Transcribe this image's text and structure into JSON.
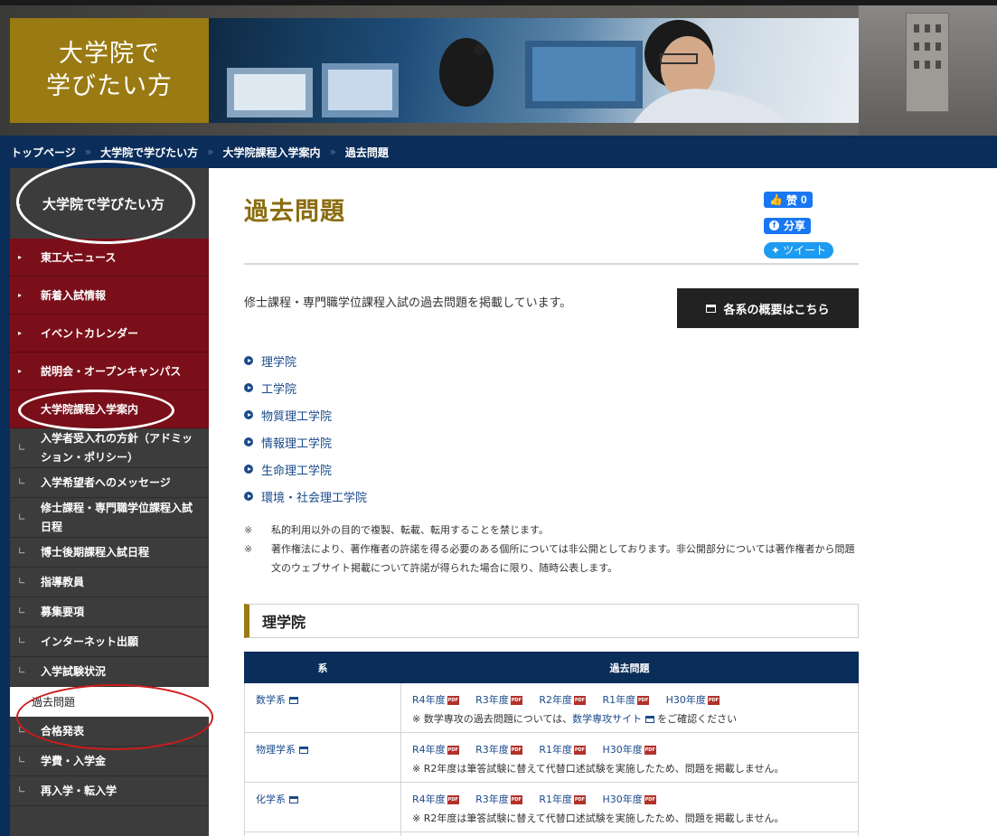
{
  "hero": {
    "title_line1": "大学院で",
    "title_line2": "学びたい方"
  },
  "breadcrumb": [
    "トップページ",
    "大学院で学びたい方",
    "大学院課程入学案内",
    "過去問題"
  ],
  "sidebar": {
    "heading": "大学院で学びたい方",
    "red_items": [
      "東工大ニュース",
      "新着入試情報",
      "イベントカレンダー",
      "説明会・オープンキャンパス",
      "大学院課程入学案内"
    ],
    "sub_items": [
      "入学者受入れの方針（アドミッション・ポリシー）",
      "入学希望者へのメッセージ",
      "修士課程・専門職学位課程入試日程",
      "博士後期課程入試日程",
      "指導教員",
      "募集要項",
      "インターネット出願",
      "入学試験状況",
      "過去問題",
      "合格発表",
      "学費・入学金",
      "再入学・転入学"
    ],
    "active_item": "過去問題"
  },
  "main": {
    "title": "過去問題",
    "social": {
      "like_label": "赞",
      "like_count": "0",
      "share_label": "分享",
      "tweet_label": "ツイート"
    },
    "intro": "修士課程・専門職学位課程入試の過去問題を掲載しています。",
    "overview_button": "各系の概要はこちら",
    "school_links": [
      "理学院",
      "工学院",
      "物質理工学院",
      "情報理工学院",
      "生命理工学院",
      "環境・社会理工学院"
    ],
    "notes": [
      {
        "mark": "※",
        "text": "私的利用以外の目的で複製、転載、転用することを禁じます。"
      },
      {
        "mark": "※",
        "text": "著作権法により、著作権者の許諾を得る必要のある個所については非公開としております。非公開部分については著作権者から問題文のウェブサイト掲載について許諾が得られた場合に限り、随時公表します。"
      }
    ],
    "section_title": "理学院",
    "table": {
      "col_dept": "系",
      "col_past": "過去問題",
      "pdf_label": "PDF",
      "rows": [
        {
          "dept": "数学系",
          "years": [
            "R4年度",
            "R3年度",
            "R2年度",
            "R1年度",
            "H30年度"
          ],
          "note_prefix": "※ 数学専攻の過去問題については、",
          "note_link": "数学専攻サイト",
          "note_suffix": "をご確認ください"
        },
        {
          "dept": "物理学系",
          "years": [
            "R4年度",
            "R3年度",
            "R1年度",
            "H30年度"
          ],
          "note_text": "※ R2年度は筆答試験に替えて代替口述試験を実施したため、問題を掲載しません。"
        },
        {
          "dept": "化学系",
          "years": [
            "R4年度",
            "R3年度",
            "R1年度",
            "H30年度"
          ],
          "note_text": "※ R2年度は筆答試験に替えて代替口述試験を実施したため、問題を掲載しません。"
        }
      ]
    }
  }
}
